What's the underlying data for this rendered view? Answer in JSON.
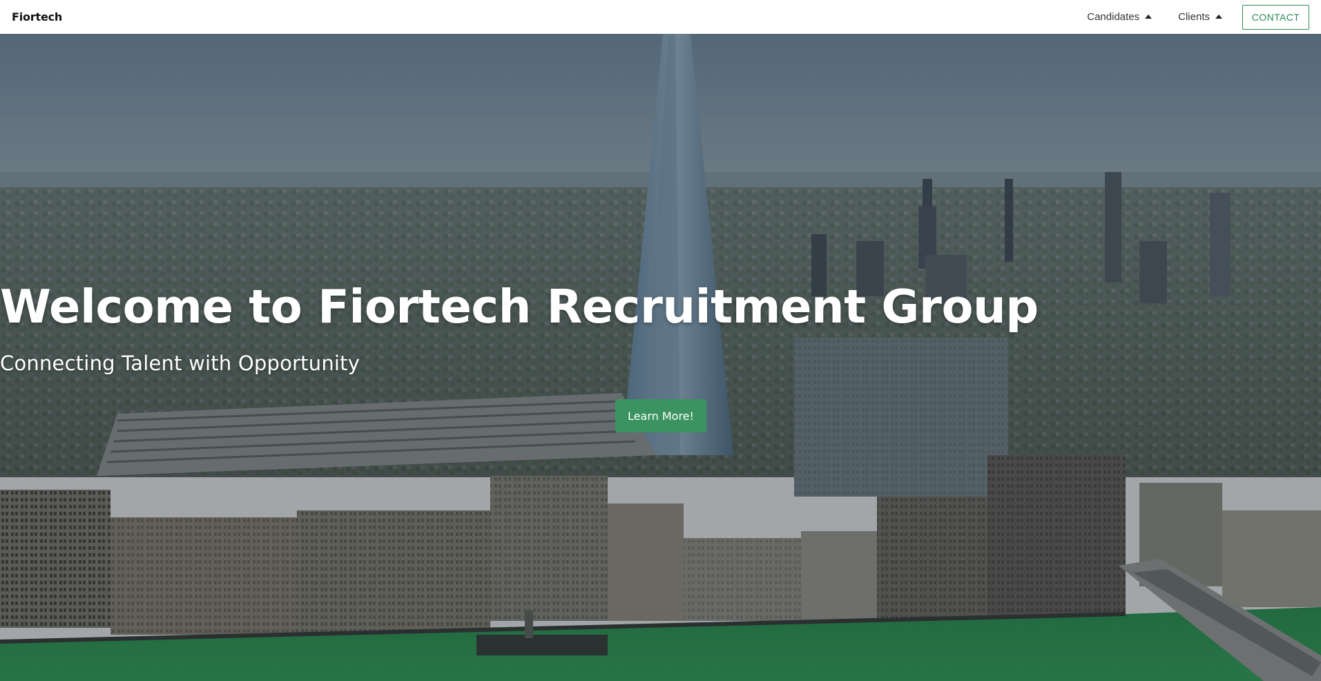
{
  "navbar": {
    "brand": "Fiortech",
    "items": [
      {
        "label": "Candidates",
        "icon": "caret-up-icon"
      },
      {
        "label": "Clients",
        "icon": "caret-up-icon"
      }
    ],
    "contact_label": "CONTACT"
  },
  "hero": {
    "title": "Welcome to Fiortech Recruitment Group",
    "subtitle": "Connecting Talent with Opportunity",
    "button_label": "Learn More!",
    "background": "aerial-london-cityscape"
  },
  "colors": {
    "accent": "#2e8b57",
    "button_bg": "#3a9360",
    "nav_bg": "#ffffff",
    "hero_text": "#ffffff"
  }
}
